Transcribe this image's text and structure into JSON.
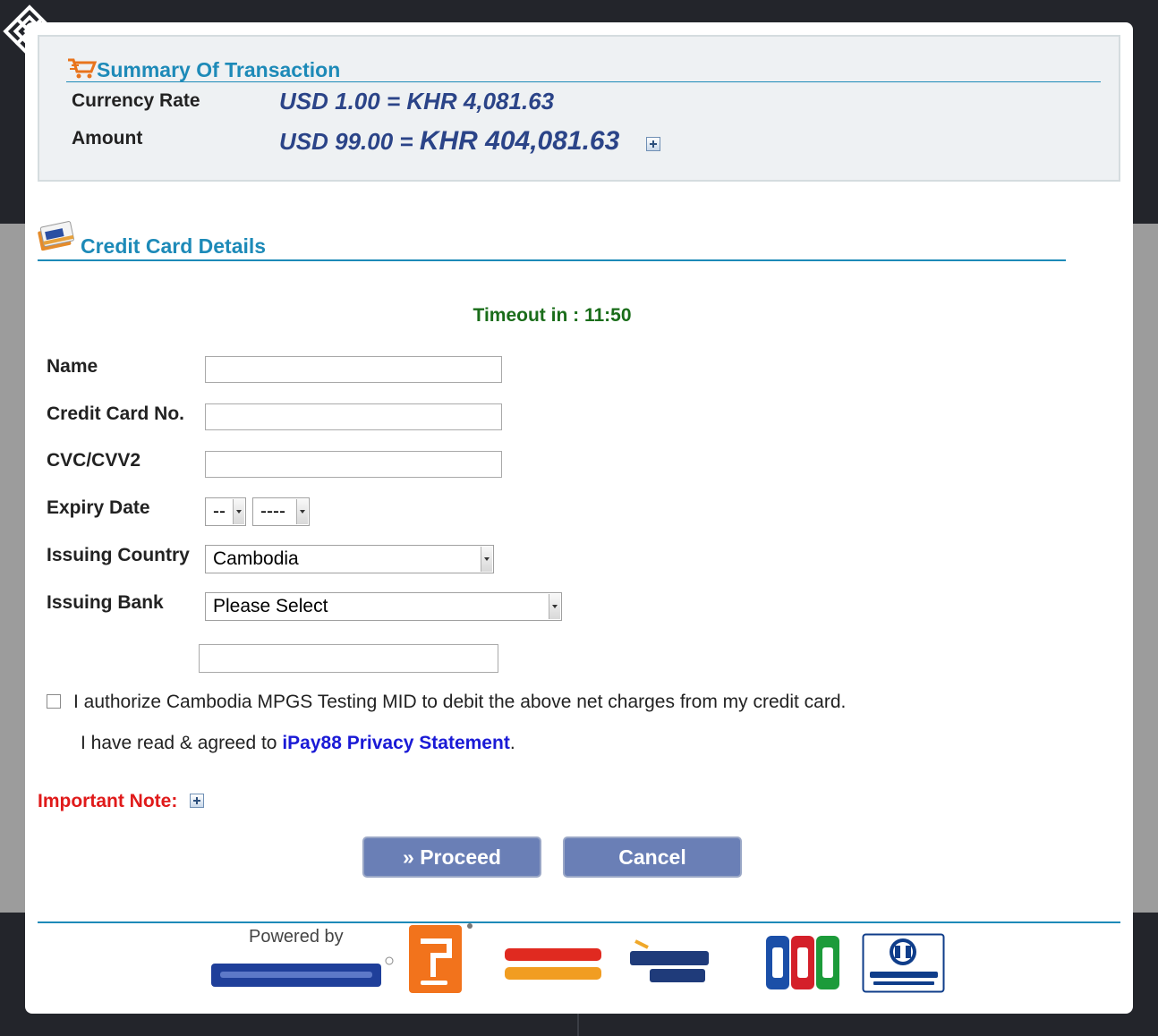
{
  "summary": {
    "title": "Summary Of Transaction",
    "currency_rate_label": "Currency Rate",
    "currency_rate_value": "USD 1.00 = KHR 4,081.63",
    "amount_label": "Amount",
    "amount_usd": "USD 99.00 = ",
    "amount_khr": "KHR 404,081.63"
  },
  "card_section": {
    "title": "Credit Card Details",
    "timeout": "Timeout in : 11:50"
  },
  "form": {
    "name_label": "Name",
    "name_value": "",
    "card_no_label": "Credit Card No.",
    "card_no_value": "",
    "cvc_label": "CVC/CVV2",
    "cvc_value": "",
    "expiry_label": "Expiry Date",
    "expiry_month": "--",
    "expiry_year": "----",
    "country_label": "Issuing Country",
    "country_value": "Cambodia",
    "bank_label": "Issuing Bank",
    "bank_value": "Please Select",
    "extra_value": ""
  },
  "consent": {
    "authorize_text": "I authorize Cambodia MPGS Testing MID to debit the above net charges from my credit card.",
    "privacy_prefix": "I have read & agreed to ",
    "privacy_link": "iPay88 Privacy Statement",
    "privacy_suffix": "."
  },
  "important_note": "Important Note:",
  "buttons": {
    "proceed": "» Proceed",
    "cancel": "Cancel"
  },
  "footer": {
    "powered_by": "Powered by",
    "logos": [
      "mobile88.com",
      "ipay88",
      "MasterCard SecureCode",
      "Verified by VISA",
      "JCB",
      "Diners Club International"
    ]
  },
  "colors": {
    "accent": "#1d8ab8",
    "value_blue": "#2b4488",
    "timeout_green": "#1a6d1a",
    "note_red": "#e01a1a",
    "button": "#6a7fb6"
  }
}
